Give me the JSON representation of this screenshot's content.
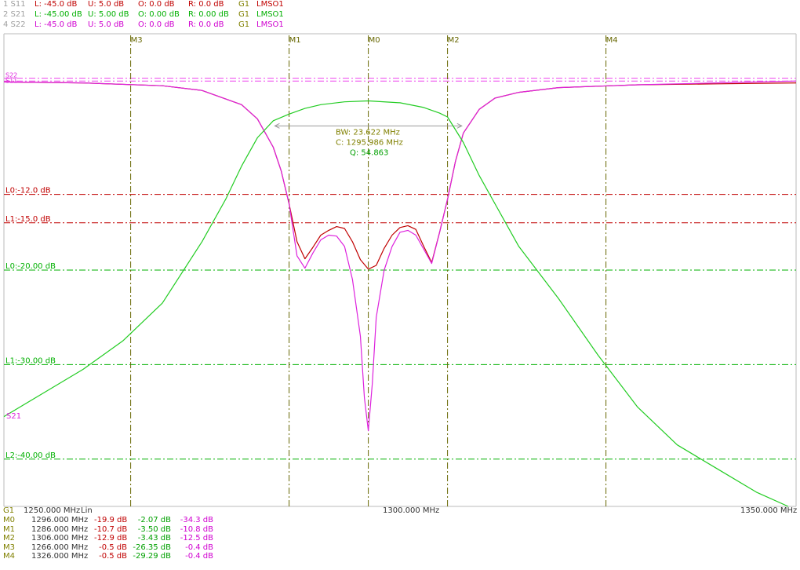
{
  "channels": [
    {
      "id": "1 S11",
      "l": "L: -45.0 dB",
      "u": "U:  5.0 dB",
      "o": "O:  0.0 dB",
      "r": "R:  0.0 dB",
      "g": "G1",
      "name": "LMSO1",
      "color": "#c00000",
      "id_color": "#a0a0a0"
    },
    {
      "id": "2 S21",
      "l": "L: -45.00 dB",
      "u": "U:  5.00 dB",
      "o": "O:  0.00 dB",
      "r": "R:  0.00 dB",
      "g": "G1",
      "name": "LMSO1",
      "color": "#00c000",
      "id_color": "#a0a0a0"
    },
    {
      "id": "4 S22",
      "l": "L: -45.0 dB",
      "u": "U:  5.0 dB",
      "o": "O:  0.0 dB",
      "r": "R:  0.0 dB",
      "g": "G1",
      "name": "LMSO1",
      "color": "#d000d0",
      "id_color": "#a0a0a0"
    }
  ],
  "colors": {
    "s11": "#c00000",
    "s21": "#22cc22",
    "s22": "#dd22dd",
    "marker": "#7a7a00",
    "grid": "#666600",
    "bw": "#999999",
    "bwtext": "#808000",
    "qtext": "#00a000",
    "red_limit": "#c00000",
    "green_limit": "#00b000"
  },
  "chart_data": {
    "type": "line",
    "x_unit": "MHz",
    "xlim": [
      1250,
      1350
    ],
    "ylim": [
      -45,
      5
    ],
    "x_start_label": "1250.000 MHz",
    "x_scale": "Lin",
    "x_center_label": "1300.000 MHz",
    "x_stop_label": "1350.000 MHz",
    "group_label": "G1",
    "markers": [
      {
        "name": "M0",
        "freq": 1296.0
      },
      {
        "name": "M1",
        "freq": 1286.0
      },
      {
        "name": "M2",
        "freq": 1306.0
      },
      {
        "name": "M3",
        "freq": 1266.0
      },
      {
        "name": "M4",
        "freq": 1326.0
      }
    ],
    "limit_lines": [
      {
        "label": "L0:-12.0 dB",
        "value": -12.0,
        "color": "red"
      },
      {
        "label": "L1:-15.0 dB",
        "value": -15.0,
        "color": "red"
      },
      {
        "label": "L0:-20.00 dB",
        "value": -20.0,
        "color": "green"
      },
      {
        "label": "L1:-30.00 dB",
        "value": -30.0,
        "color": "green"
      },
      {
        "label": "L2:-40.00 dB",
        "value": -40.0,
        "color": "green"
      }
    ],
    "ref_lines": [
      {
        "value": 0.0,
        "color": "pink"
      },
      {
        "value": 0.3,
        "color": "pink"
      }
    ],
    "trace_labels": {
      "s11": "S11",
      "s22": "S22",
      "s21": "S21"
    },
    "series": [
      {
        "name": "S11",
        "x": [
          1250,
          1260,
          1270,
          1275,
          1280,
          1282,
          1284,
          1285,
          1286,
          1287,
          1288,
          1289,
          1290,
          1291,
          1292,
          1293,
          1294,
          1295,
          1296,
          1297,
          1298,
          1299,
          1300,
          1301,
          1302,
          1303,
          1304,
          1305,
          1306,
          1307,
          1308,
          1310,
          1312,
          1315,
          1320,
          1330,
          1340,
          1350
        ],
        "y": [
          -0.1,
          -0.2,
          -0.5,
          -1.0,
          -2.5,
          -4.0,
          -7.0,
          -9.5,
          -13.0,
          -17.0,
          -18.8,
          -17.6,
          -16.3,
          -15.8,
          -15.4,
          -15.6,
          -17.0,
          -18.9,
          -19.9,
          -19.5,
          -17.7,
          -16.3,
          -15.5,
          -15.3,
          -15.7,
          -17.5,
          -19.2,
          -16.0,
          -12.5,
          -8.5,
          -5.5,
          -3.0,
          -1.8,
          -1.2,
          -0.7,
          -0.4,
          -0.3,
          -0.2
        ]
      },
      {
        "name": "S22",
        "x": [
          1250,
          1260,
          1270,
          1275,
          1280,
          1282,
          1284,
          1285,
          1286,
          1287,
          1288,
          1289,
          1290,
          1291,
          1292,
          1293,
          1294,
          1295,
          1295.5,
          1296,
          1296.5,
          1297,
          1298,
          1299,
          1300,
          1301,
          1302,
          1303,
          1304,
          1305,
          1306,
          1307,
          1308,
          1310,
          1312,
          1315,
          1320,
          1330,
          1340,
          1350
        ],
        "y": [
          -0.1,
          -0.2,
          -0.5,
          -1.0,
          -2.5,
          -4.0,
          -7.0,
          -9.5,
          -13.0,
          -18.5,
          -19.8,
          -18.2,
          -16.8,
          -16.3,
          -16.4,
          -17.5,
          -21.0,
          -27.0,
          -33.5,
          -37.0,
          -32.0,
          -25.0,
          -20.0,
          -17.5,
          -16.0,
          -15.8,
          -16.3,
          -17.8,
          -19.3,
          -16.0,
          -12.5,
          -8.5,
          -5.5,
          -3.0,
          -1.8,
          -1.2,
          -0.7,
          -0.4,
          -0.2,
          0.0
        ]
      },
      {
        "name": "S21",
        "x": [
          1250,
          1255,
          1260,
          1265,
          1270,
          1275,
          1278,
          1280,
          1282,
          1284,
          1286,
          1288,
          1290,
          1293,
          1296,
          1300,
          1303,
          1305,
          1306,
          1308,
          1310,
          1313,
          1315,
          1320,
          1325,
          1330,
          1335,
          1340,
          1345,
          1349
        ],
        "y": [
          -35.5,
          -33.0,
          -30.5,
          -27.5,
          -23.5,
          -17.0,
          -12.5,
          -9.0,
          -6.0,
          -4.2,
          -3.5,
          -2.9,
          -2.5,
          -2.2,
          -2.1,
          -2.3,
          -2.8,
          -3.4,
          -3.8,
          -6.5,
          -10.0,
          -14.5,
          -17.5,
          -23.0,
          -29.0,
          -34.5,
          -38.5,
          -41.0,
          -43.5,
          -45.0
        ]
      }
    ],
    "bw": {
      "bw": "BW:  23.622 MHz",
      "c": "C: 1295.986 MHz",
      "q": "Q: 54.863",
      "f1": 1284.2,
      "f2": 1307.8,
      "level": -3.0
    }
  },
  "marker_table": [
    {
      "name": "M0",
      "freq": "1296.000 MHz",
      "s11": "-19.9 dB",
      "s21": "-2.07 dB",
      "s22": "-34.3 dB"
    },
    {
      "name": "M1",
      "freq": "1286.000 MHz",
      "s11": "-10.7 dB",
      "s21": "-3.50 dB",
      "s22": "-10.8 dB"
    },
    {
      "name": "M2",
      "freq": "1306.000 MHz",
      "s11": "-12.9 dB",
      "s21": "-3.43 dB",
      "s22": "-12.5 dB"
    },
    {
      "name": "M3",
      "freq": "1266.000 MHz",
      "s11": "-0.5 dB",
      "s21": "-26.35 dB",
      "s22": "-0.4 dB"
    },
    {
      "name": "M4",
      "freq": "1326.000 MHz",
      "s11": "-0.5 dB",
      "s21": "-29.29 dB",
      "s22": "-0.4 dB"
    }
  ]
}
